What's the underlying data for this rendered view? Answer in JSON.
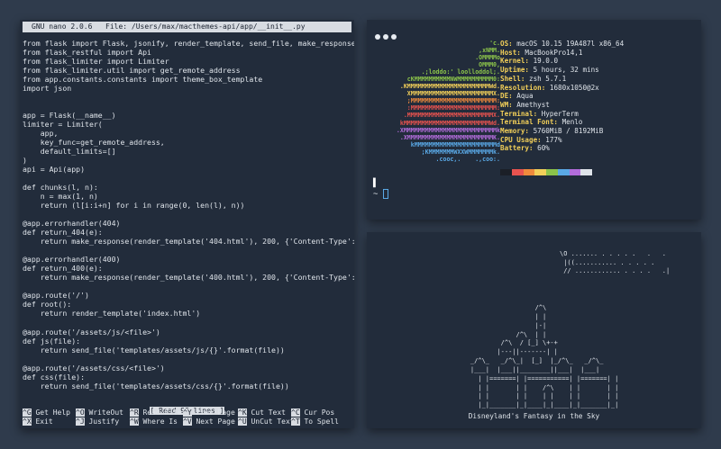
{
  "nano": {
    "version": "GNU nano 2.0.6",
    "file": "File: /Users/max/macthemes-api/app/__init__.py",
    "lines": [
      "from flask import Flask, jsonify, render_template, send_file, make_response",
      "from flask_restful import Api",
      "from flask_limiter import Limiter",
      "from flask_limiter.util import get_remote_address",
      "from app.constants.constants import theme_box_template",
      "import json",
      "",
      "",
      "app = Flask(__name__)",
      "limiter = Limiter(",
      "    app,",
      "    key_func=get_remote_address,",
      "    default_limits=[]",
      ")",
      "api = Api(app)",
      "",
      "def chunks(l, n):",
      "    n = max(1, n)",
      "    return (l[i:i+n] for i in range(0, len(l), n))",
      "",
      "@app.errorhandler(404)",
      "def return_404(e):",
      "    return make_response(render_template('404.html'), 200, {'Content-Type': 'text/ht$",
      "",
      "@app.errorhandler(400)",
      "def return_400(e):",
      "    return make_response(render_template('400.html'), 200, {'Content-Type': 'text/ht$",
      "",
      "@app.route('/')",
      "def root():",
      "    return render_template('index.html')",
      "",
      "@app.route('/assets/js/<file>')",
      "def js(file):",
      "    return send_file('templates/assets/js/{}'.format(file))",
      "",
      "@app.route('/assets/css/<file>')",
      "def css(file):",
      "    return send_file('templates/assets/css/{}'.format(file))"
    ],
    "status": "[ Read 98 lines ]",
    "shortcuts_row1": [
      {
        "key": "^G",
        "label": "Get Help"
      },
      {
        "key": "^O",
        "label": "WriteOut"
      },
      {
        "key": "^R",
        "label": "Read File"
      },
      {
        "key": "^Y",
        "label": "Prev Page"
      },
      {
        "key": "^K",
        "label": "Cut Text"
      },
      {
        "key": "^C",
        "label": "Cur Pos"
      }
    ],
    "shortcuts_row2": [
      {
        "key": "^X",
        "label": "Exit"
      },
      {
        "key": "^J",
        "label": "Justify"
      },
      {
        "key": "^W",
        "label": "Where Is"
      },
      {
        "key": "^V",
        "label": "Next Page"
      },
      {
        "key": "^U",
        "label": "UnCut Text"
      },
      {
        "key": "^T",
        "label": "To Spell"
      }
    ]
  },
  "neofetch": {
    "logo": [
      {
        "text": "'c.",
        "color": "#8bc34a"
      },
      {
        "text": ",xNMM.",
        "color": "#8bc34a"
      },
      {
        "text": ".OMMMMo",
        "color": "#8bc34a"
      },
      {
        "text": "OMMM0,",
        "color": "#8bc34a"
      },
      {
        "text": ".;loddo:' loolloddol;.",
        "color": "#8bc34a"
      },
      {
        "text": "cKMMMMMMMMMMNWMMMMMMMMMM0:",
        "color": "#8bc34a"
      },
      {
        "text": ".KMMMMMMMMMMMMMMMMMMMMMMMWd.",
        "color": "#f2cf59"
      },
      {
        "text": "XMMMMMMMMMMMMMMMMMMMMMMMX.",
        "color": "#f2cf59"
      },
      {
        "text": ";MMMMMMMMMMMMMMMMMMMMMMMM:",
        "color": "#ef8a3c"
      },
      {
        "text": ":MMMMMMMMMMMMMMMMMMMMMMMM:",
        "color": "#e8534f"
      },
      {
        "text": ".MMMMMMMMMMMMMMMMMMMMMMMMX.",
        "color": "#e8534f"
      },
      {
        "text": "kMMMMMMMMMMMMMMMMMMMMMMMMWd.",
        "color": "#e8534f"
      },
      {
        "text": ".XMMMMMMMMMMMMMMMMMMMMMMMMMMk",
        "color": "#b46ddc"
      },
      {
        "text": ".XMMMMMMMMMMMMMMMMMMMMMMMMK.",
        "color": "#b46ddc"
      },
      {
        "text": "kMMMMMMMMMMMMMMMMMMMMMMMd",
        "color": "#5aa9e6"
      },
      {
        "text": ";KMMMMMMMWXXWMMMMMMMk.",
        "color": "#5aa9e6"
      },
      {
        "text": ".cooc,.    .,coo:.",
        "color": "#5aa9e6"
      }
    ],
    "user_host": "OS: macOS 10.15 19A487l x86_64",
    "info": [
      {
        "key": "OS:",
        "value": " macOS 10.15 19A487l x86_64"
      },
      {
        "key": "Host:",
        "value": " MacBookPro14,1"
      },
      {
        "key": "Kernel:",
        "value": " 19.0.0"
      },
      {
        "key": "Uptime:",
        "value": " 5 hours, 32 mins"
      },
      {
        "key": "Shell:",
        "value": " zsh 5.7.1"
      },
      {
        "key": "Resolution:",
        "value": " 1680x1050@2x"
      },
      {
        "key": "DE:",
        "value": " Aqua"
      },
      {
        "key": "WM:",
        "value": " Amethyst"
      },
      {
        "key": "Terminal:",
        "value": " HyperTerm"
      },
      {
        "key": "Terminal Font:",
        "value": " Menlo"
      },
      {
        "key": "Memory:",
        "value": " 5760MiB / 8192MiB"
      },
      {
        "key": "CPU Usage:",
        "value": " 177%"
      },
      {
        "key": "Battery:",
        "value": " 60%"
      }
    ],
    "swatches": [
      "#1b1f27",
      "#e8534f",
      "#ef8a3c",
      "#f2cf59",
      "#8bc34a",
      "#5aa9e6",
      "#b46ddc",
      "#dfe4ea"
    ],
    "prompt": "~"
  },
  "ascii": {
    "stars": [
      "\\O ....... . . . . .   .   .",
      " |((........... . . . . .",
      " // ............ . . . .   .|"
    ],
    "castle": [
      "                          /^\\",
      "                          | |",
      "                          |-|",
      "                     /^\\  | |",
      "                 /^\\  / [_] \\+-+",
      "                |---||-------| |",
      "         _/^\\_   _/^\\_|  [_]  |_/^\\_   _/^\\_",
      "         |___|  |___||________||___|  |___|",
      "           | |=======| |===========| |=======| |",
      "           | |       | |    /^\\    | |       | |",
      "           | |       | |    | |    | |       | |",
      "           |_|_______|_|____|_|____|_|_______|_|"
    ],
    "caption": "Disneyland's Fantasy in the Sky"
  }
}
